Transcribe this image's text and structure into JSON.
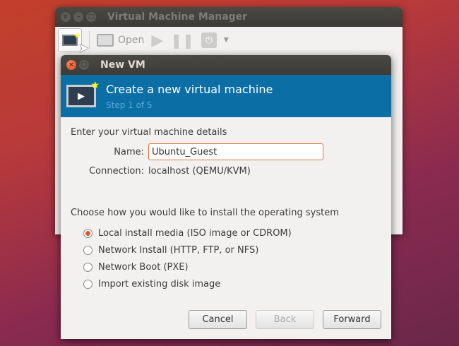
{
  "main_window": {
    "title": "Virtual Machine Manager",
    "toolbar": {
      "open_label": "Open"
    }
  },
  "dialog": {
    "title": "New VM",
    "banner_title": "Create a new virtual machine",
    "banner_step": "Step 1 of 5",
    "details_heading": "Enter your virtual machine details",
    "name_label": "Name:",
    "name_value": "Ubuntu_Guest",
    "connection_label": "Connection:",
    "connection_value": "localhost (QEMU/KVM)",
    "install_heading": "Choose how you would like to install the operating system",
    "install_options": [
      {
        "label": "Local install media (ISO image or CDROM)",
        "selected": true
      },
      {
        "label": "Network Install (HTTP, FTP, or NFS)",
        "selected": false
      },
      {
        "label": "Network Boot (PXE)",
        "selected": false
      },
      {
        "label": "Import existing disk image",
        "selected": false
      }
    ],
    "buttons": {
      "cancel": "Cancel",
      "back": "Back",
      "forward": "Forward"
    }
  }
}
